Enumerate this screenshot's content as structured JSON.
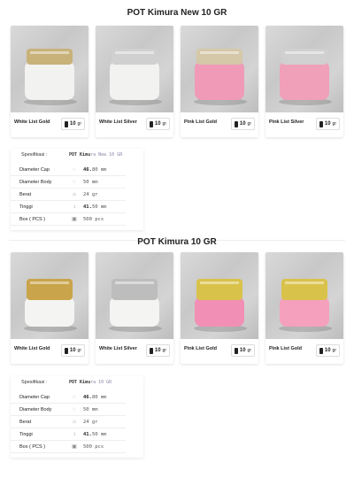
{
  "sections": [
    {
      "title": "POT Kimura New 10 GR",
      "products": [
        {
          "label": "White List Gold",
          "weight": "10",
          "unit": "gr",
          "body": "#f2f2f0",
          "cap": "#c8b27a"
        },
        {
          "label": "White List Silver",
          "weight": "10",
          "unit": "gr",
          "body": "#f2f2f0",
          "cap": "#d0d0d0"
        },
        {
          "label": "Pink List Gold",
          "weight": "10",
          "unit": "gr",
          "body": "#f09ab8",
          "cap": "#d4c8a8"
        },
        {
          "label": "Pink List Silver",
          "weight": "10",
          "unit": "gr",
          "body": "#f0a0b8",
          "cap": "#d0d0d0"
        }
      ],
      "spec": {
        "heading": "Spesifikasi :",
        "product_bold": "POT Kimu",
        "product_fade": "ra New 10 GR",
        "rows": [
          {
            "label": "Diameter Cap",
            "num": "46.",
            "rest": "80 mm",
            "icon": "◌"
          },
          {
            "label": "Diameter Body",
            "num": "",
            "rest": "50 mm",
            "icon": "◌"
          },
          {
            "label": "Berat",
            "num": "",
            "rest": "24 gr",
            "icon": "⌂"
          },
          {
            "label": "Tinggi",
            "num": "41.",
            "rest": "50 mm",
            "icon": "↕"
          },
          {
            "label": "Box ( PCS )",
            "num": "",
            "rest": "500 pcs",
            "icon": "▣"
          }
        ]
      }
    },
    {
      "title": "POT Kimura 10 GR",
      "products": [
        {
          "label": "White List Gold",
          "weight": "10",
          "unit": "gr",
          "body": "#f4f4f2",
          "cap": "#c9a44a"
        },
        {
          "label": "White List Silver",
          "weight": "10",
          "unit": "gr",
          "body": "#f4f4f2",
          "cap": "#bdbdbd"
        },
        {
          "label": "Pink List Gold",
          "weight": "10",
          "unit": "gr",
          "body": "#f28fb4",
          "cap": "#d9c24a"
        },
        {
          "label": "Pink List Gold",
          "weight": "10",
          "unit": "gr",
          "body": "#f5a0bc",
          "cap": "#d9c24a"
        }
      ],
      "spec": {
        "heading": "Spesifikasi :",
        "product_bold": "POT Kimu",
        "product_fade": "ra 10 GR",
        "rows": [
          {
            "label": "Diameter Cap",
            "num": "46.",
            "rest": "80 mm",
            "icon": "◌"
          },
          {
            "label": "Diameter Body",
            "num": "",
            "rest": "50 mm",
            "icon": "◌"
          },
          {
            "label": "Berat",
            "num": "",
            "rest": "24 gr",
            "icon": "⌂"
          },
          {
            "label": "Tinggi",
            "num": "41.",
            "rest": "50 mm",
            "icon": "↕"
          },
          {
            "label": "Box ( PCS )",
            "num": "",
            "rest": "500 pcs",
            "icon": "▣"
          }
        ]
      }
    }
  ]
}
